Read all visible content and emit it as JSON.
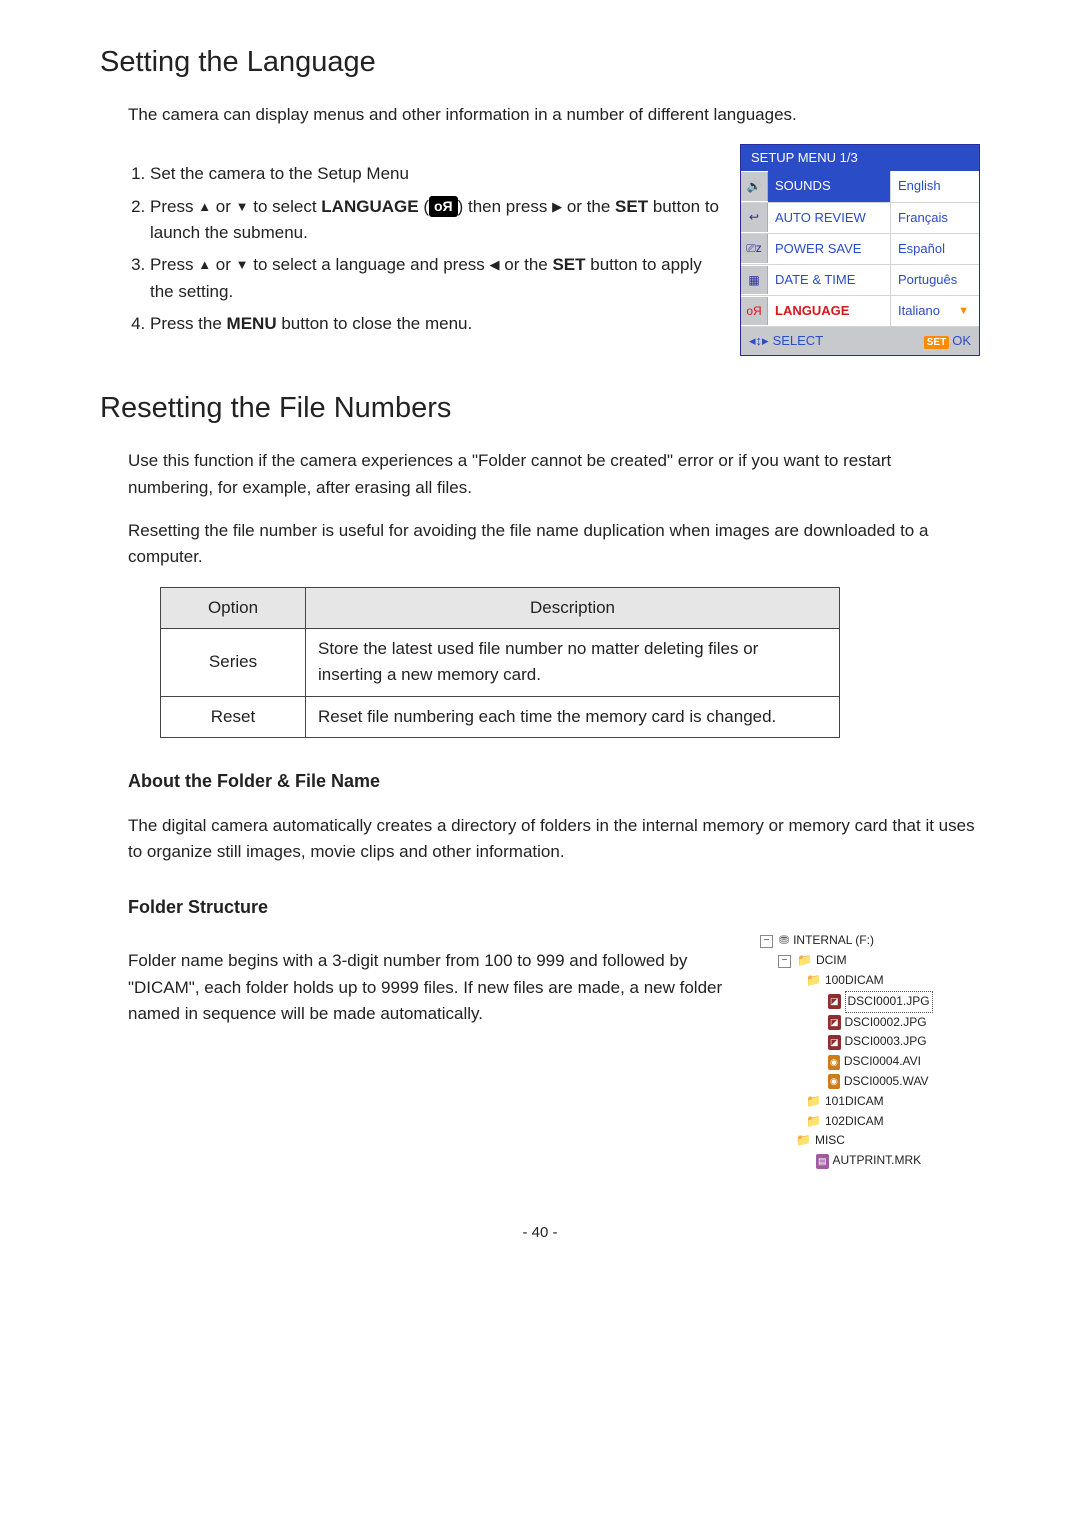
{
  "h1_lang": "Setting the Language",
  "lang_intro": "The camera can display menus and other information in a number of different languages.",
  "lang_steps": {
    "s1": "Set the camera to the Setup Menu",
    "s2a": "Press ",
    "s2b": " or ",
    "s2c": " to select ",
    "s2_label": "LANGUAGE",
    "s2d": " (",
    "s2e": ") then press ",
    "s2f": " or the ",
    "s2_set": "SET",
    "s2g": " button to launch the submenu.",
    "s3a": "Press ",
    "s3b": " or ",
    "s3c": " to select a language and press ",
    "s3d": " or the ",
    "s3_set": "SET",
    "s3e": " button to apply the setting.",
    "s4a": "Press the ",
    "s4_menu": "MENU",
    "s4b": " button to close the menu."
  },
  "osd": {
    "title": "SETUP MENU 1/3",
    "rows": [
      {
        "icon": "🔊",
        "item": "SOUNDS",
        "value": "English",
        "highlight": true
      },
      {
        "icon": "↩",
        "item": "AUTO REVIEW",
        "value": "Français"
      },
      {
        "icon": "⎚z",
        "item": "POWER SAVE",
        "value": "Español"
      },
      {
        "icon": "▦",
        "item": "DATE & TIME",
        "value": "Português"
      },
      {
        "icon": "",
        "item": "LANGUAGE",
        "value": "Italiano",
        "lang": true
      }
    ],
    "select": "SELECT",
    "ok": "OK",
    "set_chip": "SET"
  },
  "lang_icon_glyph": "oЯ",
  "h1_reset": "Resetting the File Numbers",
  "reset_p1": "Use this function if the camera experiences a \"Folder cannot be created\" error or if you want to restart numbering, for example, after erasing all files.",
  "reset_p2": "Resetting the file number is useful for avoiding the file name duplication when images are downloaded to a computer.",
  "table": {
    "head_option": "Option",
    "head_desc": "Description",
    "rows": [
      {
        "opt": "Series",
        "desc": "Store the latest used file number no matter deleting files or inserting a new memory card."
      },
      {
        "opt": "Reset",
        "desc": "Reset file numbering each time the memory card is changed."
      }
    ]
  },
  "about_head": "About the Folder & File Name",
  "about_p": "The digital camera automatically creates a directory of folders in the internal memory or memory card that it uses to organize still images, movie clips and other information.",
  "fs_head": "Folder Structure",
  "fs_p": "Folder name begins with a 3-digit number from 100 to 999 and followed by \"DICAM\", each folder holds up to 9999 files. If new files are made, a new folder named in sequence will be made automatically.",
  "tree": {
    "drive": "INTERNAL (F:)",
    "dcim": "DCIM",
    "f100": "100DICAM",
    "files100": [
      "DSCI0001.JPG",
      "DSCI0002.JPG",
      "DSCI0003.JPG",
      "DSCI0004.AVI",
      "DSCI0005.WAV"
    ],
    "f101": "101DICAM",
    "f102": "102DICAM",
    "misc": "MISC",
    "autprint": "AUTPRINT.MRK"
  },
  "page_number": "- 40 -"
}
